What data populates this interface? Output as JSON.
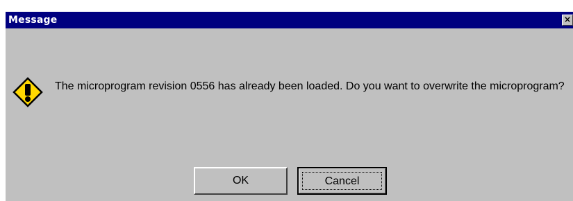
{
  "dialog": {
    "title": "Message",
    "close_glyph": "×",
    "icon": "warning-icon",
    "message": "The microprogram revision 0556 has already been loaded. Do you want to overwrite the microprogram?",
    "buttons": {
      "ok_label": "OK",
      "cancel_label": "Cancel"
    }
  },
  "colors": {
    "titlebar": "#000080",
    "dialog_bg": "#c0c0c0",
    "icon_fill": "#ffd800"
  }
}
